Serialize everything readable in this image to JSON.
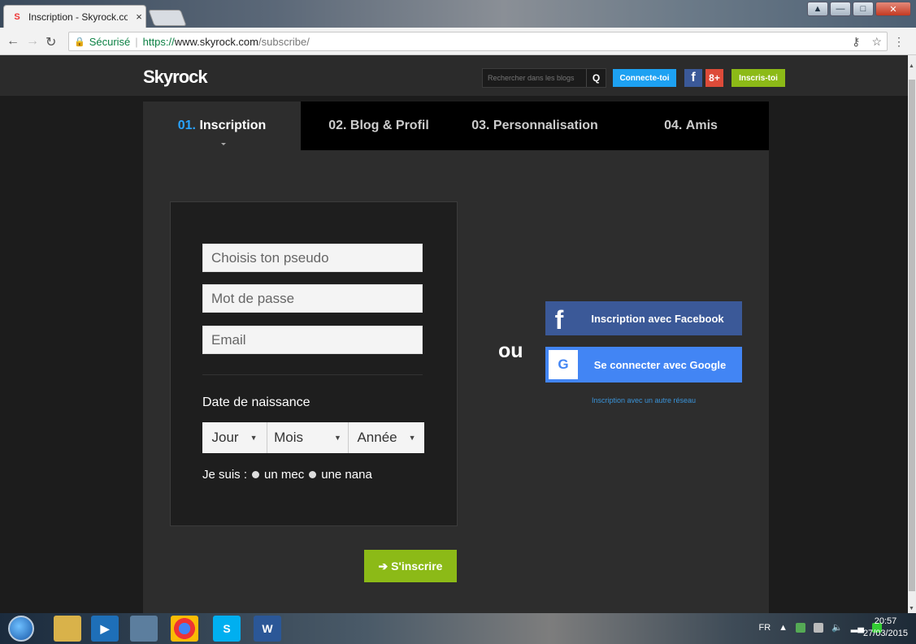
{
  "browser": {
    "tab_title": "Inscription - Skyrock.com",
    "tab_favicon": "S",
    "tab_close": "×",
    "secure_label": "Sécurisé",
    "url_protocol": "https://",
    "url_host": "www.skyrock.com",
    "url_path": "/subscribe/",
    "icons": [
      "back-icon",
      "forward-icon",
      "reload-icon",
      "lock-icon",
      "key-icon",
      "star-icon",
      "menu-icon"
    ]
  },
  "header": {
    "logo": "Skyrock",
    "search_placeholder": "Rechercher dans les blogs",
    "search_icon": "Q",
    "connect_label": "Connecte-toi",
    "facebook_icon": "f",
    "googleplus_icon": "8+",
    "signup_label": "Inscris-toi"
  },
  "steps": [
    {
      "num": "01.",
      "label": "Inscription",
      "active": true
    },
    {
      "num": "02.",
      "label": "Blog & Profil",
      "active": false
    },
    {
      "num": "03.",
      "label": "Personnalisation",
      "active": false
    },
    {
      "num": "04.",
      "label": "Amis",
      "active": false
    }
  ],
  "form": {
    "pseudo_placeholder": "Choisis ton pseudo",
    "password_placeholder": "Mot de passe",
    "email_placeholder": "Email",
    "dob_label": "Date de naissance",
    "day": "Jour",
    "month": "Mois",
    "year": "Année",
    "gender_label": "Je suis :",
    "gender_male": "un mec",
    "gender_female": "une nana",
    "submit_label": "S'inscrire",
    "submit_icon": "➔"
  },
  "social": {
    "or_label": "ou",
    "facebook_label": "Inscription avec Facebook",
    "facebook_glyph": "f",
    "google_label": "Se connecter avec Google",
    "google_glyph": "G",
    "other_network": "Inscription avec un autre réseau"
  },
  "taskbar": {
    "language": "FR",
    "time": "20:57",
    "date": "27/03/2015",
    "word_glyph": "W"
  },
  "colors": {
    "accent_blue": "#29a3ff",
    "connect_blue": "#1da1f2",
    "green": "#8cba17",
    "facebook": "#3b5998",
    "google": "#4285f4"
  }
}
